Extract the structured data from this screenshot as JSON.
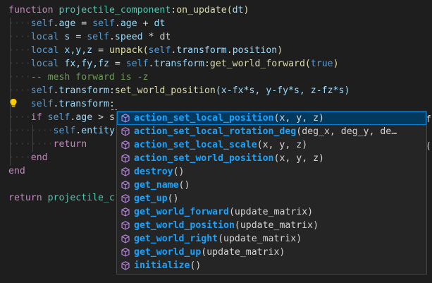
{
  "code": {
    "l1": {
      "kw": "function",
      "name": "projectile_component",
      "sep": ":",
      "method": "on_update",
      "open": "(",
      "param": "dt",
      "close": ")"
    },
    "l2": {
      "a": "self",
      "b": ".",
      "c": "age",
      "d": " = ",
      "e": "self",
      "f": ".",
      "g": "age",
      "h": " + ",
      "i": "dt"
    },
    "l3": {
      "kw": "local",
      "sp": " ",
      "v": "s",
      "eq": " = ",
      "s": "self",
      "dot": ".",
      "p": "speed",
      "rest": " * dt"
    },
    "l4": {
      "kw": "local",
      "sp": " ",
      "v": "x,y,z",
      "eq": " = ",
      "fn": "unpack",
      "o": "(",
      "s": "self",
      "d1": ".",
      "t": "transform",
      "d2": ".",
      "p": "position",
      "c": ")"
    },
    "l5": {
      "kw": "local",
      "sp": " ",
      "v": "fx,fy,fz",
      "eq": " = ",
      "s": "self",
      "d1": ".",
      "t": "transform",
      "col": ":",
      "fn": "get_world_forward",
      "o": "(",
      "b": "true",
      "c": ")"
    },
    "l6": {
      "cm": "-- mesh forward is -z"
    },
    "l7": {
      "s": "self",
      "d1": ".",
      "t": "transform",
      "col": ":",
      "fn": "set_world_position",
      "args": "(x-fx*s, y-fy*s, z-fz*s)"
    },
    "l8": {
      "s": "self",
      "d1": ".",
      "t": "transform",
      "col": ":"
    },
    "l9": {
      "kw": "if",
      "sp": " ",
      "s": "self",
      "d": ".",
      "p": "age",
      "rest": " > s"
    },
    "l10": {
      "s": "self",
      "d": ".",
      "p": "entity"
    },
    "l11": {
      "kw": "return"
    },
    "l12": {
      "kw": "end"
    },
    "l13": {
      "kw": "end"
    },
    "l14": {
      "kw": "return",
      "sp": " ",
      "v": "projectile_c"
    }
  },
  "suggestions": [
    {
      "hl": "action_set_local_position",
      "rest": "(x, y, z)",
      "selected": true
    },
    {
      "hl": "action_set_local_rotation_deg",
      "rest": "(deg_x, deg_y, de…",
      "selected": false
    },
    {
      "hl": "action_set_local_scale",
      "rest": "(x, y, z)",
      "selected": false
    },
    {
      "hl": "action_set_world_position",
      "rest": "(x, y, z)",
      "selected": false
    },
    {
      "hl": "destroy",
      "rest": "()",
      "selected": false
    },
    {
      "hl": "get_name",
      "rest": "()",
      "selected": false
    },
    {
      "hl": "get_up",
      "rest": "()",
      "selected": false
    },
    {
      "hl": "get_world_forward",
      "rest": "(update_matrix)",
      "selected": false
    },
    {
      "hl": "get_world_position",
      "rest": "(update_matrix)",
      "selected": false
    },
    {
      "hl": "get_world_right",
      "rest": "(update_matrix)",
      "selected": false
    },
    {
      "hl": "get_world_up",
      "rest": "(update_matrix)",
      "selected": false
    },
    {
      "hl": "initialize",
      "rest": "()",
      "selected": false
    }
  ],
  "side_fragments": {
    "top": "f",
    "mid": "("
  },
  "icons": {
    "lightbulb": "lightbulb-icon",
    "method": "method-cube-icon"
  },
  "colors": {
    "background": "#1e1e1e",
    "selection": "#04395e",
    "focus_border": "#007fd4",
    "keyword": "#c586c0",
    "function": "#dcdcaa",
    "type": "#4ec9b0",
    "comment": "#6a9955",
    "bulb": "#ffcc00",
    "method_icon": "#b180d7"
  }
}
